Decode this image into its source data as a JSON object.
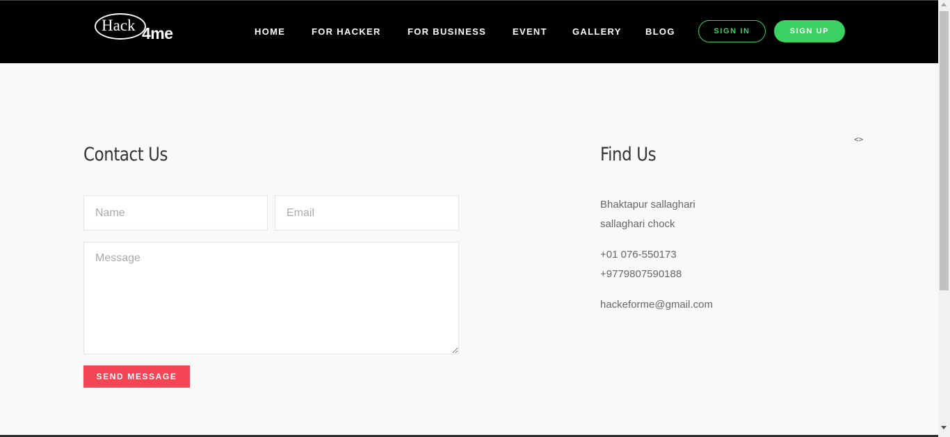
{
  "brand": {
    "logo_text_left": "Hack",
    "logo_text_right": "4me"
  },
  "nav": {
    "items": [
      {
        "label": "HOME"
      },
      {
        "label": "FOR HACKER"
      },
      {
        "label": "FOR BUSINESS"
      },
      {
        "label": "EVENT"
      },
      {
        "label": "GALLERY"
      },
      {
        "label": "BLOG"
      }
    ],
    "sign_in": "SIGN IN",
    "sign_up": "SIGN UP"
  },
  "contact": {
    "title": "Contact Us",
    "name_placeholder": "Name",
    "email_placeholder": "Email",
    "message_placeholder": "Message",
    "send_label": "SEND MESSAGE"
  },
  "find_us": {
    "title": "Find Us",
    "address_line1": "Bhaktapur sallaghari",
    "address_line2": "sallaghari chock",
    "phone1": "+01 076-550173",
    "phone2": "+9779807590188",
    "email": "hackeforme@gmail.com"
  },
  "icons": {
    "code": "<>"
  },
  "colors": {
    "accent_green": "#3cd163",
    "send_red": "#f44556",
    "navbar_bg": "#000000"
  }
}
